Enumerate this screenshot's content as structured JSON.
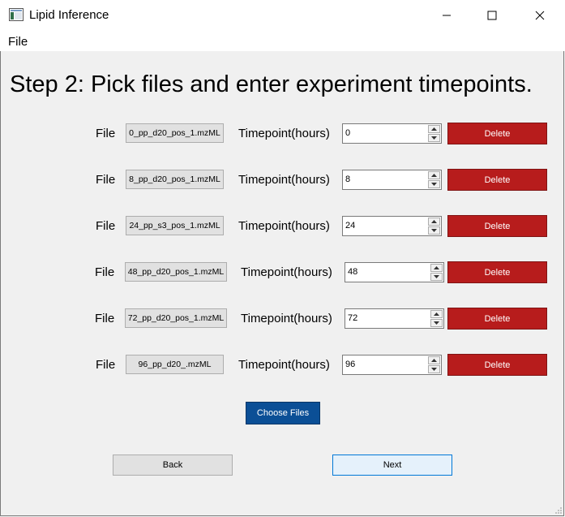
{
  "window": {
    "title": "Lipid Inference"
  },
  "menu": {
    "file": "File"
  },
  "heading": "Step 2: Pick files and enter experiment timepoints.",
  "rows": [
    {
      "file_label": "File",
      "filename": "0_pp_d20_pos_1.mzML",
      "timepoint_label": "Timepoint(hours)",
      "timepoint": "0",
      "delete_label": "Delete"
    },
    {
      "file_label": "File",
      "filename": "8_pp_d20_pos_1.mzML",
      "timepoint_label": "Timepoint(hours)",
      "timepoint": "8",
      "delete_label": "Delete"
    },
    {
      "file_label": "File",
      "filename": "24_pp_s3_pos_1.mzML",
      "timepoint_label": "Timepoint(hours)",
      "timepoint": "24",
      "delete_label": "Delete"
    },
    {
      "file_label": "File",
      "filename": "48_pp_d20_pos_1.mzML",
      "timepoint_label": "Timepoint(hours)",
      "timepoint": "48",
      "delete_label": "Delete"
    },
    {
      "file_label": "File",
      "filename": "72_pp_d20_pos_1.mzML",
      "timepoint_label": "Timepoint(hours)",
      "timepoint": "72",
      "delete_label": "Delete"
    },
    {
      "file_label": "File",
      "filename": "96_pp_d20_.mzML",
      "timepoint_label": "Timepoint(hours)",
      "timepoint": "96",
      "delete_label": "Delete"
    }
  ],
  "choose_files_label": "Choose Files",
  "back_label": "Back",
  "next_label": "Next",
  "colors": {
    "delete": "#b71c1c",
    "choose": "#0b4f96",
    "next_border": "#0078d7"
  }
}
